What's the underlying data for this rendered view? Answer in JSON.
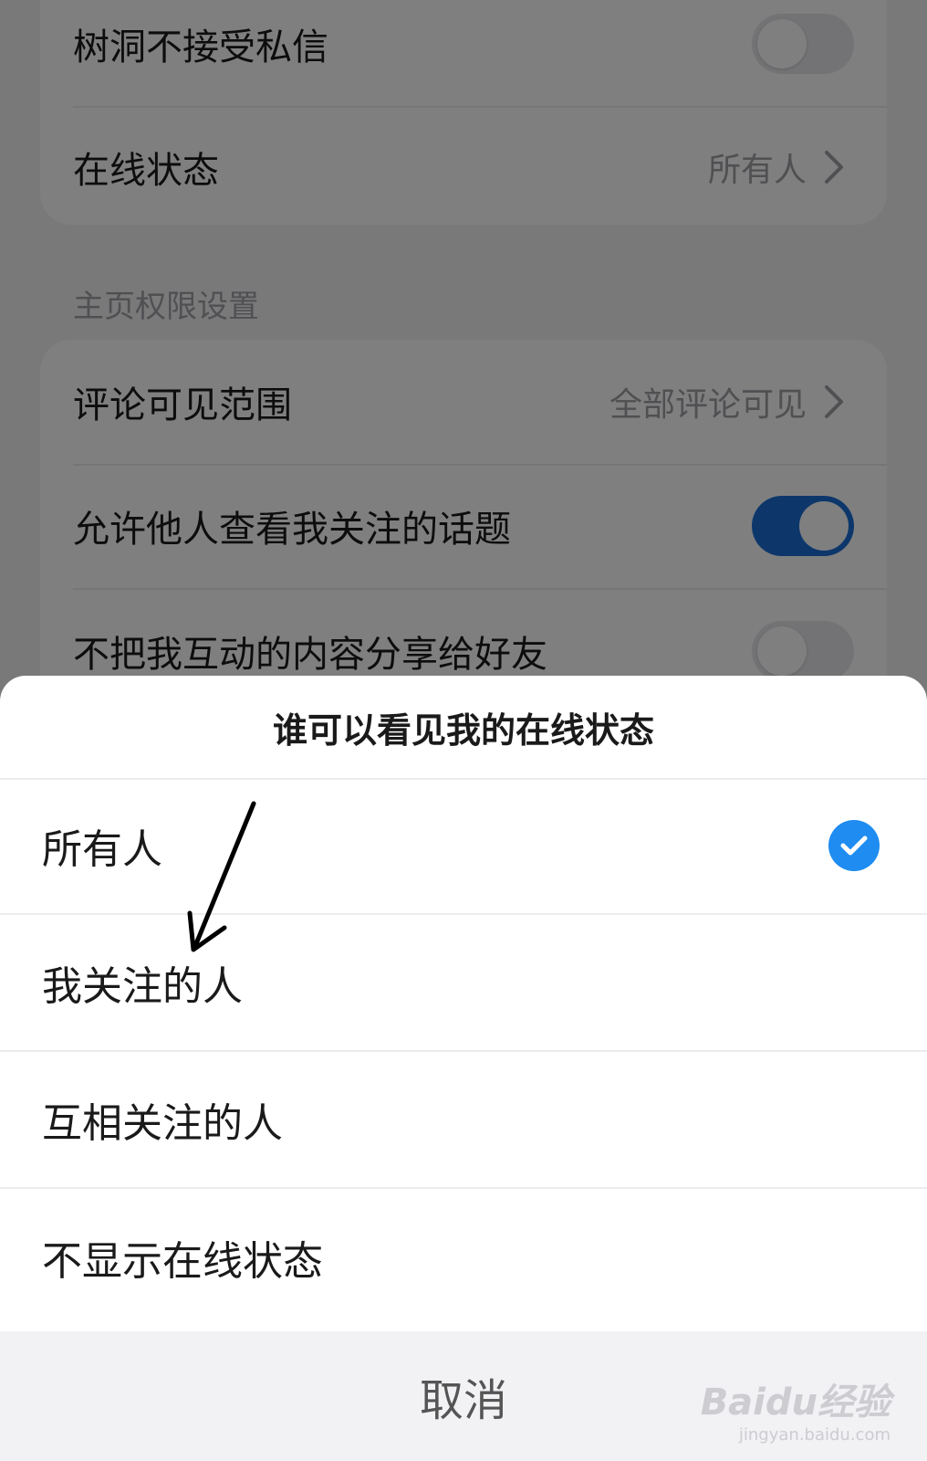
{
  "settings": {
    "rows_top": [
      {
        "label": "树洞不接受私信",
        "toggle": "off"
      },
      {
        "label": "在线状态",
        "value": "所有人"
      }
    ],
    "section_title": "主页权限设置",
    "rows_bottom": [
      {
        "label": "评论可见范围",
        "value": "全部评论可见"
      },
      {
        "label": "允许他人查看我关注的话题",
        "toggle": "on"
      },
      {
        "label": "不把我互动的内容分享给好友",
        "toggle": "off"
      }
    ]
  },
  "sheet": {
    "title": "谁可以看见我的在线状态",
    "options": [
      {
        "label": "所有人",
        "selected": true
      },
      {
        "label": "我关注的人",
        "selected": false
      },
      {
        "label": "互相关注的人",
        "selected": false
      },
      {
        "label": "不显示在线状态",
        "selected": false
      }
    ],
    "cancel_label": "取消"
  },
  "colors": {
    "accent_toggle": "#1a6fd6",
    "check": "#1e8cf0"
  },
  "watermark": {
    "logo": "Baidu经验",
    "url": "jingyan.baidu.com"
  }
}
